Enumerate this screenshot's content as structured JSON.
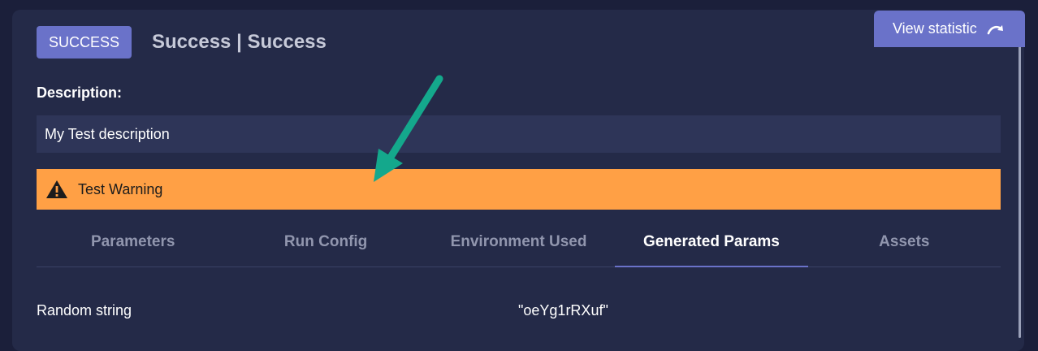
{
  "header": {
    "status_badge": "SUCCESS",
    "title": "Success | Success",
    "view_statistic_label": "View statistic"
  },
  "description": {
    "label": "Description:",
    "value": "My Test description"
  },
  "warning": {
    "text": "Test Warning"
  },
  "tabs": [
    {
      "label": "Parameters"
    },
    {
      "label": "Run Config"
    },
    {
      "label": "Environment Used"
    },
    {
      "label": "Generated Params"
    },
    {
      "label": "Assets"
    }
  ],
  "active_tab": "Generated Params",
  "params": [
    {
      "name": "Random string",
      "value": "\"oeYg1rRXuf\""
    }
  ],
  "colors": {
    "accent": "#6a72c9",
    "warning": "#ffa045",
    "annotation_arrow": "#14a88c"
  },
  "icons": {
    "warning": "warning-triangle-icon",
    "statistic": "redo-arrow-icon"
  }
}
